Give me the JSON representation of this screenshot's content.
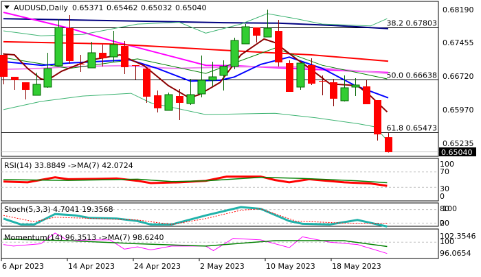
{
  "header": {
    "symbol": "AUDUSD,Daily",
    "open": "0.65371",
    "high": "0.65462",
    "low": "0.65032",
    "close": "0.65040"
  },
  "colors": {
    "bull": "#32cd32",
    "bear": "#ff0000",
    "grid": "#c0c0c0"
  },
  "price_axis": {
    "ticks": [
      "0.68190",
      "0.67455",
      "0.66720",
      "0.65970",
      "0.65235"
    ],
    "current": "0.65040"
  },
  "fib_levels": [
    {
      "label": "38.2 0.67803",
      "price": 0.67803
    },
    {
      "label": "50.0 0.66638",
      "price": 0.66638
    },
    {
      "label": "61.8 0.65473",
      "price": 0.65473
    }
  ],
  "date_axis": [
    {
      "label": "6 Apr 2023",
      "index": 0
    },
    {
      "label": "14 Apr 2023",
      "index": 6
    },
    {
      "label": "24 Apr 2023",
      "index": 12
    },
    {
      "label": "2 May 2023",
      "index": 18
    },
    {
      "label": "10 May 2023",
      "index": 24
    },
    {
      "label": "18 May 2023",
      "index": 30
    }
  ],
  "chart_data": [
    {
      "type": "candlestick",
      "title": "AUDUSD,Daily",
      "ylim": [
        0.65,
        0.6828
      ],
      "ohlc": [
        [
          0.6719,
          0.67236,
          0.66539,
          0.66705
        ],
        [
          0.66705,
          0.66705,
          0.66417,
          0.6663
        ],
        [
          0.66584,
          0.66584,
          0.66205,
          0.66417
        ],
        [
          0.66296,
          0.66796,
          0.66296,
          0.66539
        ],
        [
          0.66478,
          0.67236,
          0.66463,
          0.66887
        ],
        [
          0.66948,
          0.67978,
          0.66948,
          0.67796
        ],
        [
          0.67781,
          0.68069,
          0.66993,
          0.67054
        ],
        [
          0.66993,
          0.6719,
          0.66811,
          0.6698
        ],
        [
          0.66902,
          0.67478,
          0.66902,
          0.67236
        ],
        [
          0.67236,
          0.67417,
          0.66933,
          0.67114
        ],
        [
          0.67145,
          0.6772,
          0.67039,
          0.67417
        ],
        [
          0.67387,
          0.67493,
          0.66766,
          0.66917
        ],
        [
          0.66963,
          0.66963,
          0.66645,
          0.66955
        ],
        [
          0.66887,
          0.66887,
          0.6613,
          0.66266
        ],
        [
          0.66296,
          0.66402,
          0.65918,
          0.66008
        ],
        [
          0.65963,
          0.66357,
          0.65963,
          0.66311
        ],
        [
          0.66281,
          0.66433,
          0.65751,
          0.6613
        ],
        [
          0.66114,
          0.6666,
          0.66084,
          0.66311
        ],
        [
          0.66327,
          0.67175,
          0.66251,
          0.6663
        ],
        [
          0.6663,
          0.67039,
          0.66493,
          0.66705
        ],
        [
          0.66736,
          0.67069,
          0.66402,
          0.66933
        ],
        [
          0.66933,
          0.67569,
          0.66872,
          0.67508
        ],
        [
          0.67433,
          0.67872,
          0.67433,
          0.67811
        ],
        [
          0.67796,
          0.67796,
          0.67463,
          0.67614
        ],
        [
          0.67584,
          0.6819,
          0.67584,
          0.67781
        ],
        [
          0.6772,
          0.67963,
          0.66933,
          0.67023
        ],
        [
          0.67008,
          0.67069,
          0.66372,
          0.66372
        ],
        [
          0.66478,
          0.67008,
          0.66417,
          0.67008
        ],
        [
          0.66963,
          0.67114,
          0.66524,
          0.66554
        ],
        [
          0.66614,
          0.66736,
          0.66296,
          0.66605
        ],
        [
          0.66584,
          0.6666,
          0.66054,
          0.66221
        ],
        [
          0.66175,
          0.66736,
          0.6616,
          0.66463
        ],
        [
          0.66478,
          0.66675,
          0.66281,
          0.66524
        ],
        [
          0.66493,
          0.6663,
          0.66099,
          0.66099
        ],
        [
          0.6619,
          0.6619,
          0.65296,
          0.65433
        ],
        [
          0.65371,
          0.65462,
          0.65032,
          0.6504
        ]
      ],
      "lines": [
        {
          "name": "ma-navy",
          "color": "#000080",
          "width": 2,
          "points": [
            [
              0,
              0.6799
            ],
            [
              20,
              0.679
            ],
            [
              25,
              0.6789
            ],
            [
              30,
              0.6784
            ],
            [
              35,
              0.6777
            ]
          ]
        },
        {
          "name": "ma-magenta",
          "color": "#ff00ff",
          "width": 2,
          "points": [
            [
              0,
              0.6813
            ],
            [
              6,
              0.6778
            ],
            [
              10,
              0.6749
            ],
            [
              18.4,
              0.6696
            ],
            [
              21,
              0.6695
            ],
            [
              26,
              0.6689
            ],
            [
              35,
              0.668
            ]
          ]
        },
        {
          "name": "ma-red",
          "color": "#ff0000",
          "width": 2,
          "points": [
            [
              0,
              0.6748
            ],
            [
              10,
              0.6743
            ],
            [
              21,
              0.6728
            ],
            [
              28,
              0.6719
            ],
            [
              35,
              0.6705
            ]
          ]
        },
        {
          "name": "ma-violet",
          "color": "#ee82ee",
          "width": 2,
          "points": [
            [
              0,
              0.6687
            ],
            [
              3.4,
              0.6689
            ],
            [
              6,
              0.6693
            ],
            [
              11,
              0.6695
            ],
            [
              15.3,
              0.6689
            ],
            [
              21.6,
              0.6693
            ],
            [
              27.8,
              0.6692
            ],
            [
              35,
              0.6678
            ]
          ]
        },
        {
          "name": "bb-upper",
          "color": "#3cb371",
          "width": 1,
          "points": [
            [
              0,
              0.6772
            ],
            [
              3.4,
              0.6761
            ],
            [
              7.2,
              0.6764
            ],
            [
              12.2,
              0.6787
            ],
            [
              16,
              0.6791
            ],
            [
              18.4,
              0.6767
            ],
            [
              21.6,
              0.6787
            ],
            [
              24,
              0.681
            ],
            [
              26.6,
              0.6799
            ],
            [
              29,
              0.6787
            ],
            [
              33.4,
              0.6783
            ],
            [
              34.9,
              0.6799
            ]
          ]
        },
        {
          "name": "bb-lower",
          "color": "#3cb371",
          "width": 1,
          "points": [
            [
              0,
              0.6598
            ],
            [
              3.4,
              0.6616
            ],
            [
              7.2,
              0.6628
            ],
            [
              11.6,
              0.6634
            ],
            [
              13.4,
              0.6613
            ],
            [
              18.4,
              0.6587
            ],
            [
              24.7,
              0.659
            ],
            [
              28.4,
              0.658
            ],
            [
              32.2,
              0.6567
            ],
            [
              33.8,
              0.656
            ],
            [
              34.9,
              0.653
            ]
          ]
        },
        {
          "name": "bb-middle",
          "color": "#008000",
          "width": 1,
          "points": [
            [
              0,
              0.6713
            ],
            [
              6,
              0.6689
            ],
            [
              12.2,
              0.671
            ],
            [
              18.4,
              0.6678
            ],
            [
              24.7,
              0.6734
            ],
            [
              29,
              0.6696
            ],
            [
              34.9,
              0.6666
            ]
          ]
        },
        {
          "name": "ema-blue",
          "color": "#0000ff",
          "width": 2,
          "points": [
            [
              0,
              0.6704
            ],
            [
              3.5,
              0.6696
            ],
            [
              6,
              0.6701
            ],
            [
              11.5,
              0.6708
            ],
            [
              14,
              0.6689
            ],
            [
              17,
              0.6661
            ],
            [
              19.7,
              0.6663
            ],
            [
              21,
              0.667
            ],
            [
              23.4,
              0.6698
            ],
            [
              26,
              0.6714
            ],
            [
              29,
              0.6689
            ],
            [
              32,
              0.6651
            ],
            [
              35,
              0.6624
            ]
          ]
        },
        {
          "name": "ma-darkred",
          "color": "#8b0000",
          "width": 2,
          "points": [
            [
              0,
              0.6721
            ],
            [
              1,
              0.6719
            ],
            [
              2.2,
              0.6689
            ],
            [
              3.4,
              0.6666
            ],
            [
              4,
              0.6663
            ],
            [
              5.3,
              0.6683
            ],
            [
              7.8,
              0.6707
            ],
            [
              10.6,
              0.6719
            ],
            [
              12.8,
              0.6695
            ],
            [
              15,
              0.6651
            ],
            [
              16.9,
              0.6624
            ],
            [
              17.8,
              0.6631
            ],
            [
              19.7,
              0.6658
            ],
            [
              21.6,
              0.6719
            ],
            [
              23.7,
              0.6754
            ],
            [
              24.7,
              0.6746
            ],
            [
              26.6,
              0.6711
            ],
            [
              27.8,
              0.669
            ],
            [
              29.7,
              0.6655
            ],
            [
              32.2,
              0.6651
            ],
            [
              33.4,
              0.6628
            ],
            [
              34.9,
              0.6593
            ]
          ]
        }
      ]
    },
    {
      "type": "line",
      "title": "RSI(14) 33.8849  ->MA(7) 42.0724",
      "ylim": [
        0,
        100
      ],
      "levels": [
        70,
        30
      ],
      "ticks": [
        "100",
        "70",
        "30",
        "0"
      ],
      "series": [
        {
          "name": "RSI",
          "color": "#ff0000",
          "width": 3,
          "points": [
            [
              0,
              45
            ],
            [
              2.2,
              43
            ],
            [
              4.7,
              56
            ],
            [
              5.9,
              51
            ],
            [
              8.4,
              52
            ],
            [
              10.3,
              53
            ],
            [
              12.2,
              47
            ],
            [
              13.4,
              41
            ],
            [
              16,
              43
            ],
            [
              18.4,
              47
            ],
            [
              20.3,
              58
            ],
            [
              23.4,
              58
            ],
            [
              24.7,
              49
            ],
            [
              26,
              43
            ],
            [
              27.8,
              51
            ],
            [
              29,
              48
            ],
            [
              31,
              43
            ],
            [
              33.4,
              40
            ],
            [
              34.9,
              34
            ]
          ]
        },
        {
          "name": "MA(7)",
          "color": "#008000",
          "width": 1.5,
          "points": [
            [
              0,
              50
            ],
            [
              5.9,
              48
            ],
            [
              12.2,
              51
            ],
            [
              15.3,
              45
            ],
            [
              18.4,
              47
            ],
            [
              23.4,
              56
            ],
            [
              27.2,
              53
            ],
            [
              32.2,
              47
            ],
            [
              34.9,
              42
            ]
          ]
        }
      ]
    },
    {
      "type": "line",
      "title": "Stoch(5,3,3) 4.7041 19.3568",
      "ylim": [
        0,
        100
      ],
      "levels": [
        80,
        20
      ],
      "ticks": [
        "80",
        "100",
        "20",
        "0"
      ],
      "series": [
        {
          "name": "Main",
          "color": "#20b2aa",
          "width": 3,
          "points": [
            [
              0,
              40
            ],
            [
              1.6,
              14
            ],
            [
              2.8,
              14
            ],
            [
              4.7,
              60
            ],
            [
              6.6,
              54
            ],
            [
              7.8,
              43
            ],
            [
              10.3,
              40
            ],
            [
              12.2,
              29
            ],
            [
              13.4,
              14
            ],
            [
              15.3,
              14
            ],
            [
              18.4,
              54
            ],
            [
              21.6,
              91
            ],
            [
              23.4,
              83
            ],
            [
              26,
              29
            ],
            [
              27.2,
              17
            ],
            [
              29.7,
              14
            ],
            [
              32.2,
              34
            ],
            [
              34.9,
              4.7
            ]
          ]
        },
        {
          "name": "Signal",
          "color": "#ff0000",
          "width": 1,
          "dash": "2,2",
          "points": [
            [
              0,
              54
            ],
            [
              2.8,
              26
            ],
            [
              4.7,
              46
            ],
            [
              12.2,
              34
            ],
            [
              15.3,
              14
            ],
            [
              18.4,
              40
            ],
            [
              21.6,
              77
            ],
            [
              23.4,
              83
            ],
            [
              26.6,
              29
            ],
            [
              31,
              20
            ],
            [
              34.9,
              19.36
            ]
          ]
        }
      ]
    },
    {
      "type": "line",
      "title": "Momentum(14) 96.3513  ->MA(7) 98.6240",
      "ylim": [
        94.5,
        104.5
      ],
      "levels": [
        100
      ],
      "ticks": [
        "102.3546",
        "100",
        "96.0654"
      ],
      "series": [
        {
          "name": "Momentum",
          "color": "#ff00ff",
          "width": 1,
          "points": [
            [
              0,
              99.25
            ],
            [
              0.9,
              98.75
            ],
            [
              3.4,
              99.5
            ],
            [
              4.7,
              103
            ],
            [
              5.9,
              100.5
            ],
            [
              7.8,
              100.75
            ],
            [
              9.7,
              100.75
            ],
            [
              11,
              97.75
            ],
            [
              12.2,
              98.5
            ],
            [
              13.4,
              97.5
            ],
            [
              15.3,
              98.75
            ],
            [
              18.4,
              98.75
            ],
            [
              19.1,
              97.25
            ],
            [
              20.9,
              101.25
            ],
            [
              23.4,
              100.75
            ],
            [
              26,
              98.25
            ],
            [
              27.2,
              101.75
            ],
            [
              29.7,
              100
            ],
            [
              32.2,
              99.25
            ],
            [
              34.9,
              96.35
            ]
          ]
        },
        {
          "name": "MA(7)",
          "color": "#008000",
          "width": 1.5,
          "points": [
            [
              0,
              101
            ],
            [
              5.9,
              100.5
            ],
            [
              12.2,
              99.5
            ],
            [
              18.4,
              98.75
            ],
            [
              24.7,
              100.5
            ],
            [
              31,
              100.5
            ],
            [
              34.9,
              98.62
            ]
          ]
        }
      ]
    }
  ]
}
